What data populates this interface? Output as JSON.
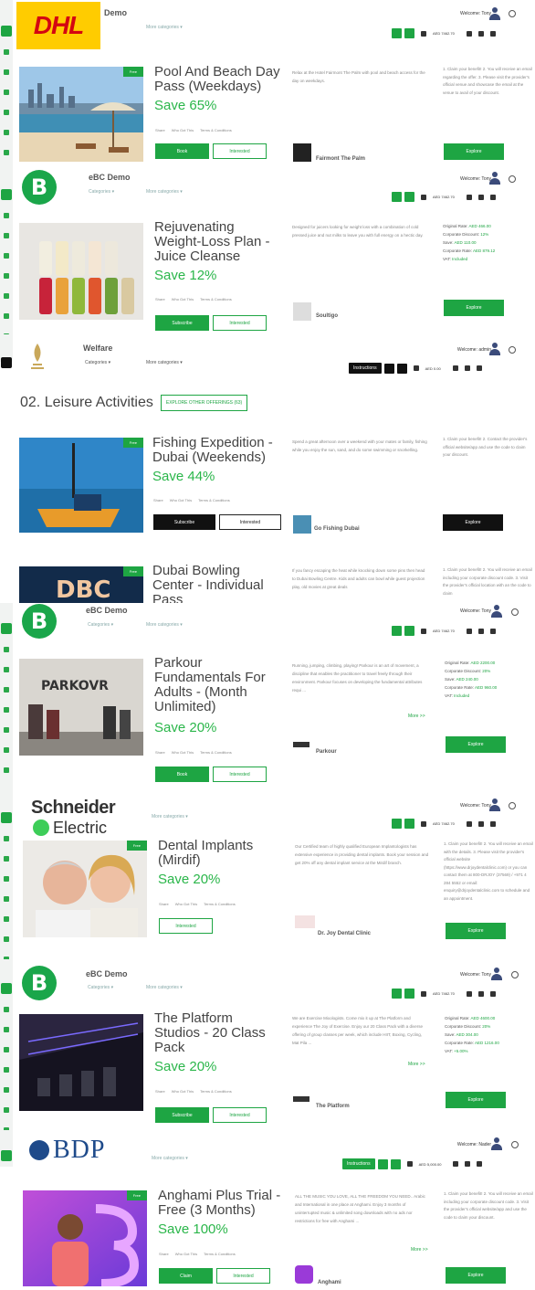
{
  "panels": [
    {
      "company": "Demo",
      "menu1": "",
      "menu2": "More categories ▾",
      "welcome": "Welcome: Tony",
      "wallet": "AED 7462.70",
      "deal": {
        "badge": "Free",
        "title": "Pool And Beach Day Pass (Weekdays)",
        "save": "Save 65%",
        "actions": [
          "Share",
          "Who Got This",
          "Terms & Conditions"
        ],
        "main_btn": "Book",
        "interested_btn": "Interested",
        "desc": "Relax at the Hotel Fairmont The Palm with pool and beach access for the day on weekdays.",
        "provider": "Fairmont The Palm",
        "claim": "1. Claim your benefit! 2. You will receive an email regarding the offer. 3. Please visit the provider's official venue and showcase the email at the venue to avail of your discount.",
        "explore": "Explore"
      }
    },
    {
      "company": "eBC Demo",
      "menu1": "Categories ▾",
      "menu2": "More categories ▾",
      "welcome": "Welcome: Tony",
      "wallet": "AED 7462.70",
      "deal": {
        "title": "Rejuvenating Weight-Loss Plan - Juice Cleanse",
        "save": "Save 12%",
        "actions": [
          "Share",
          "Who Got This",
          "Terms & Conditions"
        ],
        "main_btn": "Subscribe",
        "interested_btn": "Interested",
        "desc": "Designed for juicers looking for weight loss with a combination of cold pressed juice and nut milks to leave you with full energy on a hectic day.",
        "provider": "Soultigo",
        "rates": [
          {
            "label": "Original Rate:",
            "value": "AED 466.00"
          },
          {
            "label": "Corporate Discount:",
            "value": "12%"
          },
          {
            "label": "Save:",
            "value": "AED 110.00"
          },
          {
            "label": "Corporate Rate:",
            "value": "AED 879.12"
          },
          {
            "label": "VAT:",
            "value": "Included"
          }
        ],
        "explore": "Explore"
      }
    },
    {
      "company": "Welfare",
      "menu1": "Categories ▾",
      "menu2": "More categories ▾",
      "welcome": "Welcome: admin",
      "instructions": "Instructions",
      "wallet": "AED 0.00",
      "section_title": "02. Leisure Activities",
      "section_btn": "EXPLORE OTHER OFFERINGS (63)",
      "deal": {
        "badge": "Free",
        "title": "Fishing Expedition - Dubai (Weekends)",
        "save": "Save 44%",
        "actions": [
          "Share",
          "Who Got This",
          "Terms & Conditions"
        ],
        "main_btn": "Subscribe",
        "interested_btn": "Interested",
        "desc": "Spend a great afternoon over a weekend with your mates or family, fishing while you enjoy the sun, sand, and do some swimming or snorkelling.",
        "provider": "Go Fishing Dubai",
        "claim": "1. Claim your benefit! 2. Contact the provider's official website/app and use the code to claim your discount.",
        "explore": "Explore"
      },
      "deal2": {
        "badge": "Free",
        "title": "Dubai Bowling Center - Individual Pass",
        "desc": "If you fancy escaping the heat while knocking down some pins then head to Dubai Bowling Centre. Kids and adults can bowl while guest projection play, old movies at great deals",
        "claim": "1. Claim your benefit! 2. You will receive an email including your corporate discount code. 3. Visit the provider's official location with an the code to claim"
      }
    },
    {
      "company": "eBC Demo",
      "menu1": "Categories ▾",
      "menu2": "More categories ▾",
      "welcome": "Welcome: Tony",
      "wallet": "AED 7462.70",
      "deal": {
        "title": "Parkour Fundamentals For Adults - (Month Unlimited)",
        "save": "Save 20%",
        "actions": [
          "Share",
          "Who Got This",
          "Terms & Conditions"
        ],
        "main_btn": "Book",
        "interested_btn": "Interested",
        "desc": "Running, jumping, climbing, playing! Parkour is an art of movement, a discipline that enables the practitioner to travel freely through their environment. Parkour focuses on developing the fundamental attributes requi ...",
        "more": "More >>",
        "provider": "Parkour",
        "rates": [
          {
            "label": "Original Rate:",
            "value": "AED 2200.00"
          },
          {
            "label": "Corporate Discount:",
            "value": "20%"
          },
          {
            "label": "Save:",
            "value": "AED 240.00"
          },
          {
            "label": "Corporate Rate:",
            "value": "AED 960.00"
          },
          {
            "label": "VAT:",
            "value": "Included"
          }
        ],
        "explore": "Explore"
      }
    },
    {
      "company": "",
      "logo1": "Schneider",
      "logo2": "Electric",
      "menu1": "",
      "menu2": "More categories ▾",
      "welcome": "Welcome: Tony",
      "wallet": "AED 7462.70",
      "deal": {
        "badge": "Free",
        "title": "Dental Implants (Mirdif)",
        "save": "Save 20%",
        "actions": [
          "Share",
          "Who Got This",
          "Terms & Conditions"
        ],
        "interested_btn": "Interested",
        "desc": "Our Certified team of highly qualified European Implantologists has extensive experience in providing dental implants. Book your session and get 20% off any dental implant service at the Mirdif branch.",
        "provider": "Dr. Joy Dental Clinic",
        "claim": "1. Claim your benefit! 2. You will receive an email with the details. 3. Please visit the provider's official website (https://www.drjoydentalclinic.com) or you can contact them at 800-DRJOY (37569) / +971 4 284 5552 or email: enquiry@drjoydentalclinic.com to schedule and an appointment.",
        "explore": "Explore"
      }
    },
    {
      "company": "eBC Demo",
      "menu1": "Categories ▾",
      "menu2": "More categories ▾",
      "welcome": "Welcome: Tony",
      "wallet": "AED 7462.70",
      "deal": {
        "title": "The Platform Studios - 20 Class Pack",
        "save": "Save 20%",
        "actions": [
          "Share",
          "Who Got This",
          "Terms & Conditions"
        ],
        "main_btn": "Subscribe",
        "interested_btn": "Interested",
        "desc": "We are Exercise Mixologists. Come mix it up at The Platform and experience The Joy of Exercise. Enjoy our 20 Class Pack with a diverse offering of group classes per week, which include HIIT, Boxing, Cycling, Mat Pila ...",
        "more": "More >>",
        "provider": "The Platform",
        "rates": [
          {
            "label": "Original Rate:",
            "value": "AED 4600.00"
          },
          {
            "label": "Corporate Discount:",
            "value": "20%"
          },
          {
            "label": "Save:",
            "value": "AED 304.00"
          },
          {
            "label": "Corporate Rate:",
            "value": "AED 1216.00"
          },
          {
            "label": "VAT:",
            "value": "+5.00%"
          }
        ],
        "explore": "Explore"
      }
    },
    {
      "company": "",
      "logo1": "BDP",
      "menu1": "",
      "menu2": "More categories ▾",
      "welcome": "Welcome: Nader",
      "instructions": "Instructions",
      "wallet": "AED 5,000.00",
      "deal": {
        "badge": "Free",
        "title": "Anghami Plus Trial - Free (3 Months)",
        "save": "Save 100%",
        "actions": [
          "Share",
          "Who Got This",
          "Terms & Conditions"
        ],
        "main_btn": "Claim",
        "interested_btn": "Interested",
        "desc": "ALL THE MUSIC YOU LOVE, ALL THE FREEDOM YOU NEED.. Arabic and International in one place at Anghami. Enjoy 3 months of uninterrupted music & unlimited song downloads with no ads nor restrictions for free with Anghami ...",
        "more": "More >>",
        "provider": "Anghami",
        "claim": "1. Claim your benefit! 2. You will receive an email including your corporate discount code. 3. Visit the provider's official website/app and use the code to claim your discount.",
        "explore": "Explore"
      }
    }
  ],
  "colors": {
    "accent": "#1ea543",
    "save": "#2ab64a",
    "dark": "#111111",
    "dhl_yellow": "#ffcc00",
    "dhl_red": "#d40511"
  },
  "icons": [
    "avatar-icon",
    "power-icon",
    "heart-icon",
    "flag-icon",
    "search-icon",
    "wallet-icon",
    "share-icon"
  ]
}
